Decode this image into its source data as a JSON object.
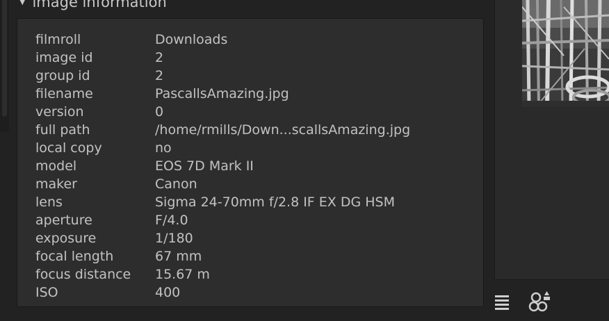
{
  "module": {
    "title": "image information",
    "expanded": true
  },
  "image_info": [
    {
      "key": "filmroll",
      "value": "Downloads"
    },
    {
      "key": "image id",
      "value": "2"
    },
    {
      "key": "group id",
      "value": "2"
    },
    {
      "key": "filename",
      "value": "PascallsAmazing.jpg"
    },
    {
      "key": "version",
      "value": "0"
    },
    {
      "key": "full path",
      "value": "/home/rmills/Down...scallsAmazing.jpg"
    },
    {
      "key": "local copy",
      "value": "no"
    },
    {
      "key": "model",
      "value": "EOS 7D Mark II"
    },
    {
      "key": "maker",
      "value": "Canon"
    },
    {
      "key": "lens",
      "value": "Sigma 24-70mm f/2.8 IF EX DG HSM"
    },
    {
      "key": "aperture",
      "value": "F/4.0"
    },
    {
      "key": "exposure",
      "value": "1/180"
    },
    {
      "key": "focal length",
      "value": "67 mm"
    },
    {
      "key": "focus distance",
      "value": "15.67 m"
    },
    {
      "key": "ISO",
      "value": "400"
    }
  ],
  "icons": {
    "menu": "hamburger-icon",
    "styles": "overlapping-circles-icon"
  },
  "colors": {
    "background": "#222222",
    "panel": "#2d2d2d",
    "text": "#c2c2c2"
  }
}
